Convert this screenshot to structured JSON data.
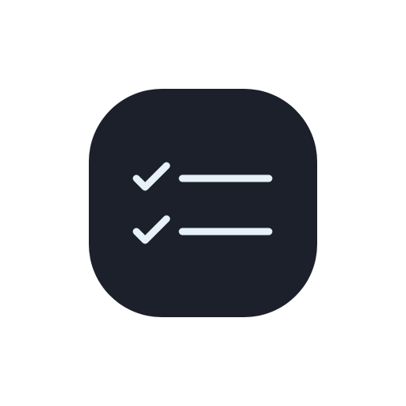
{
  "app_icon": {
    "icon": "checklist-icon",
    "background_color": "#1c202b",
    "glyph_color": "#e6f1f8",
    "rows": [
      {
        "icon": "checkmark-icon",
        "checked": true
      },
      {
        "icon": "checkmark-icon",
        "checked": true
      }
    ]
  }
}
